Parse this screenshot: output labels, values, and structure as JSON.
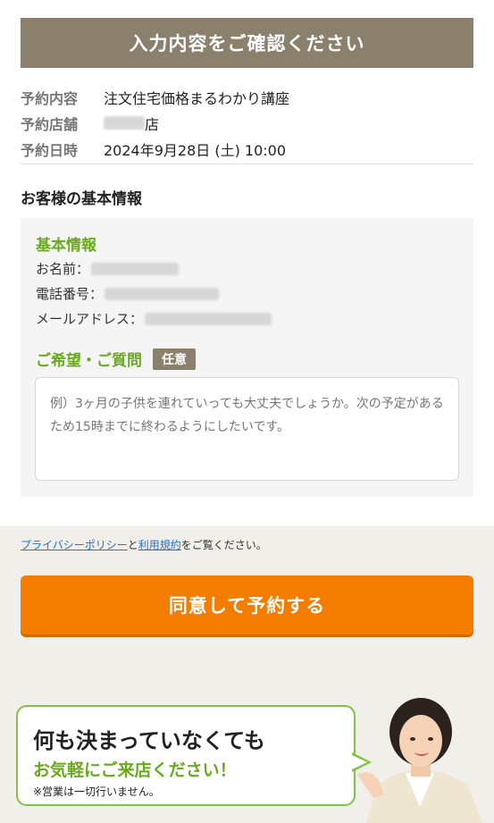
{
  "header": {
    "title": "入力内容をご確認ください"
  },
  "summary": {
    "rows": [
      {
        "label": "予約内容",
        "value": "注文住宅価格まるわかり講座"
      },
      {
        "label": "予約店舗",
        "value": "店"
      },
      {
        "label": "予約日時",
        "value": "2024年9月28日 (土) 10:00"
      }
    ]
  },
  "customer": {
    "section_title": "お客様の基本情報",
    "basic_title": "基本情報",
    "name_label": "お名前：",
    "phone_label": "電話番号：",
    "email_label": "メールアドレス：",
    "request_title": "ご希望・ご質問",
    "optional_badge": "任意",
    "request_placeholder": "例）3ヶ月の子供を連れていっても大丈夫でしょうか。次の予定があるため15時までに終わるようにしたいです。"
  },
  "consent": {
    "privacy_link": "プライバシーポリシー",
    "and": "と",
    "terms_link": "利用規約",
    "suffix": "をご覧ください。",
    "agree_button": "同意して予約する"
  },
  "promo": {
    "line1": "何も決まっていなくても",
    "line2": "お気軽にご来店ください！",
    "line3": "※営業は一切行いません。"
  },
  "colors": {
    "header_bg": "#8a806b",
    "accent_green": "#6aaa1e",
    "button_orange": "#f47d00",
    "link_blue": "#2a6fc9"
  }
}
